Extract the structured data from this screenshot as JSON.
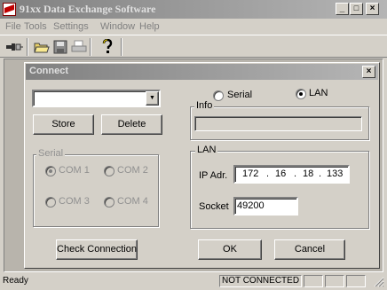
{
  "app": {
    "title": "91xx Data Exchange Software",
    "min_label": "_",
    "max_label": "□",
    "close_label": "×"
  },
  "menu": [
    "File",
    "Tools",
    "Settings",
    "Window",
    "Help"
  ],
  "toolbar": [
    "connect-icon",
    "open-folder-icon",
    "save-icon",
    "print-icon",
    "help-icon"
  ],
  "dialog": {
    "title": "Connect",
    "close_label": "×",
    "device_select": {
      "value": ""
    },
    "store_label": "Store",
    "delete_label": "Delete",
    "mode": {
      "serial_label": "Serial",
      "lan_label": "LAN",
      "selected": "LAN"
    },
    "info": {
      "legend": "Info",
      "value": ""
    },
    "serial_group": {
      "legend": "Serial",
      "ports": [
        "COM 1",
        "COM 2",
        "COM 3",
        "COM 4"
      ],
      "selected": "COM 1",
      "enabled": false
    },
    "lan_group": {
      "legend": "LAN",
      "ip_label": "IP Adr.",
      "ip": [
        "172",
        "16",
        "18",
        "133"
      ],
      "ip_dot": ".",
      "socket_label": "Socket",
      "socket_value": "49200"
    },
    "check_connection_label": "Check Connection",
    "ok_label": "OK",
    "cancel_label": "Cancel"
  },
  "status": {
    "text": "Ready",
    "connection": "NOT CONNECTED"
  }
}
